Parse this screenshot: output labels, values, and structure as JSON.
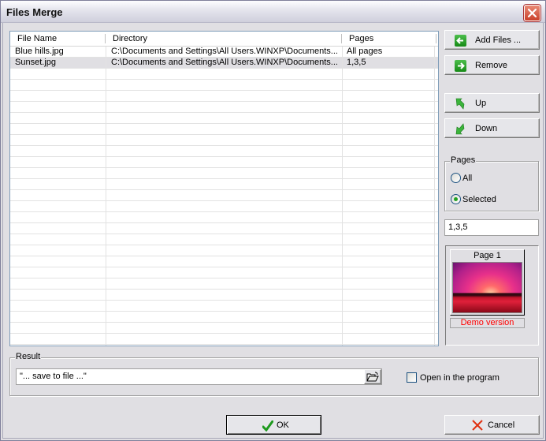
{
  "window": {
    "title": "Files Merge"
  },
  "list": {
    "columns": [
      "File Name",
      "Directory",
      "Pages"
    ],
    "rows": [
      {
        "file_name": "Blue hills.jpg",
        "directory": "C:\\Documents and Settings\\All Users.WINXP\\Documents...",
        "pages": "All pages",
        "selected": false
      },
      {
        "file_name": "Sunset.jpg",
        "directory": "C:\\Documents and Settings\\All Users.WINXP\\Documents...",
        "pages": "1,3,5",
        "selected": true
      }
    ]
  },
  "buttons": {
    "add_files": "Add Files ...",
    "remove": "Remove",
    "up": "Up",
    "down": "Down",
    "ok": "OK",
    "cancel": "Cancel"
  },
  "pages_group": {
    "label": "Pages",
    "options": [
      "All",
      "Selected"
    ],
    "selected": "Selected",
    "range_value": "1,3,5"
  },
  "preview": {
    "page_label": "Page 1",
    "watermark": "Demo version"
  },
  "result": {
    "label": "Result",
    "output_value": "\"... save to file ...\"",
    "open_in_program_label": "Open in the program",
    "open_in_program_checked": false
  },
  "colors": {
    "demo_text": "#ff0000",
    "selected_row": "#e0dfe3",
    "icon_green": "#1e9a1e",
    "cancel_red": "#e03010"
  }
}
